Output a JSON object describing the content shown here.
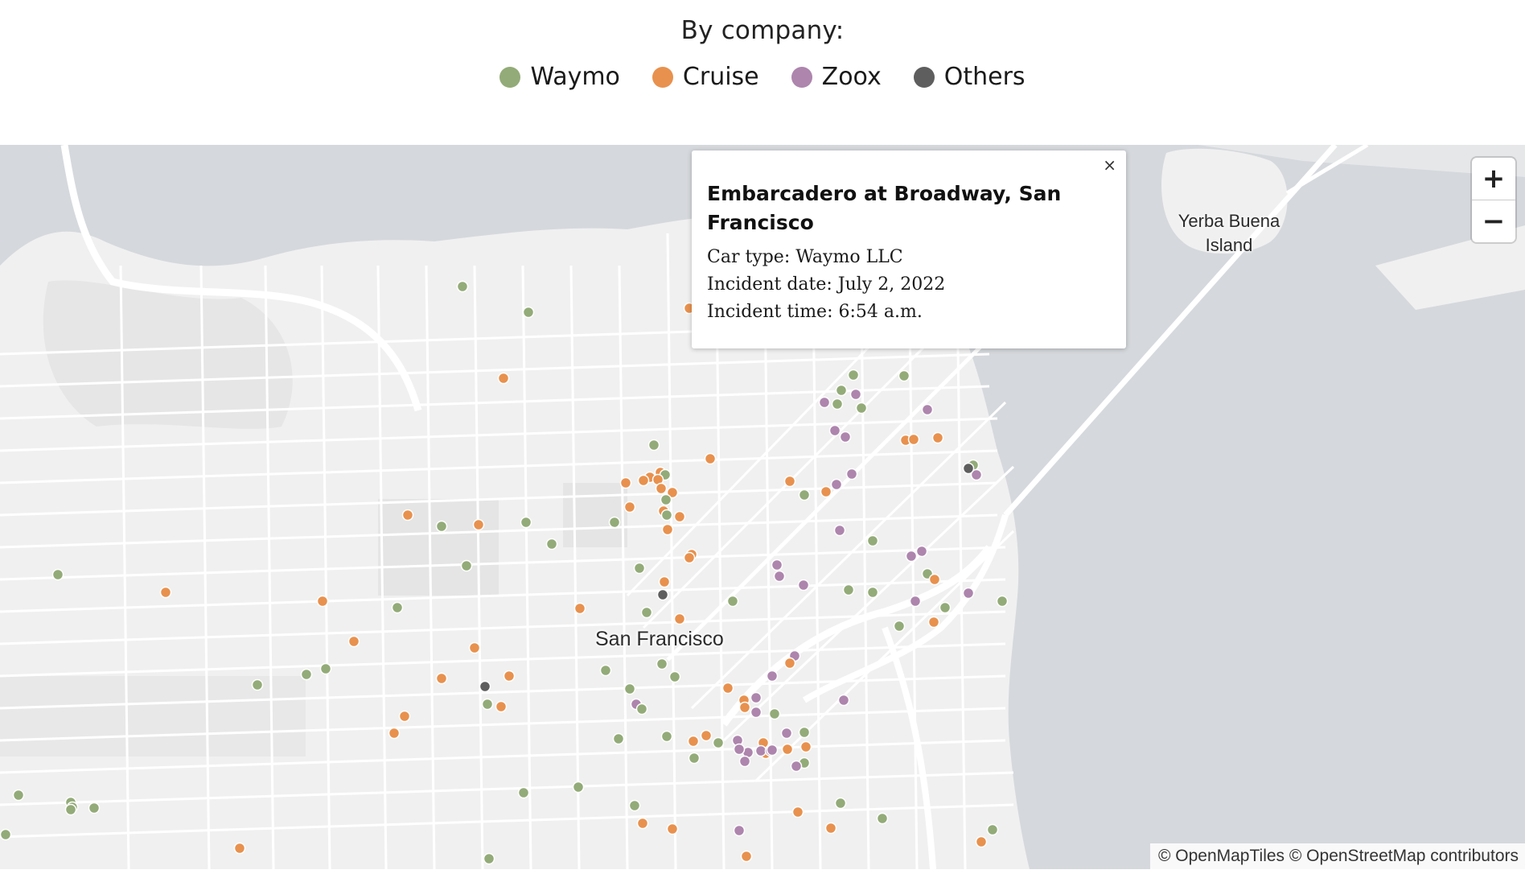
{
  "legend": {
    "title": "By company:",
    "items": [
      {
        "label": "Waymo",
        "color": "#93ab78"
      },
      {
        "label": "Cruise",
        "color": "#e8914e"
      },
      {
        "label": "Zoox",
        "color": "#ad85ad"
      },
      {
        "label": "Others",
        "color": "#5e5e5e"
      }
    ]
  },
  "map": {
    "labels": {
      "city": "San Francisco",
      "island": "Yerba Buena Island"
    },
    "zoom": {
      "in": "+",
      "out": "−"
    },
    "attribution": "© OpenMapTiles © OpenStreetMap contributors"
  },
  "popup": {
    "close": "×",
    "title": "Embarcadero at Broadway, San Francisco",
    "car_type": "Car type: Waymo LLC",
    "incident_date": "Incident date: July 2, 2022",
    "incident_time": "Incident time: 6:54 a.m."
  }
}
